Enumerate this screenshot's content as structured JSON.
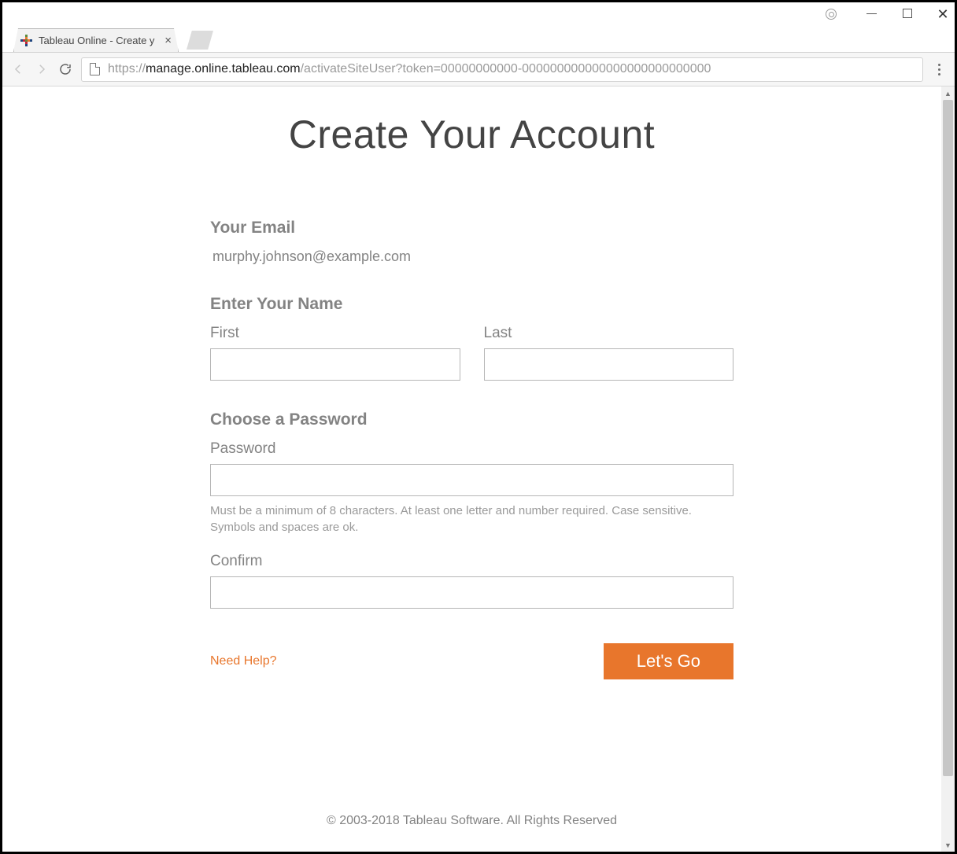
{
  "window": {
    "tab_title": "Tableau Online - Create y"
  },
  "addressbar": {
    "protocol": "https://",
    "host": "manage.online.tableau.com",
    "path": "/activateSiteUser?token=00000000000-000000000000000000000000000"
  },
  "page": {
    "title": "Create Your Account",
    "email_section": {
      "heading": "Your Email",
      "value": "murphy.johnson@example.com"
    },
    "name_section": {
      "heading": "Enter Your Name",
      "first_label": "First",
      "last_label": "Last",
      "first_value": "",
      "last_value": ""
    },
    "password_section": {
      "heading": "Choose a Password",
      "password_label": "Password",
      "password_value": "",
      "help_text": "Must be a minimum of 8 characters. At least one letter and number required. Case sensitive. Symbols and spaces are ok.",
      "confirm_label": "Confirm",
      "confirm_value": ""
    },
    "help_link": "Need Help?",
    "submit_label": "Let's Go",
    "footer": "© 2003-2018 Tableau Software. All Rights Reserved"
  }
}
